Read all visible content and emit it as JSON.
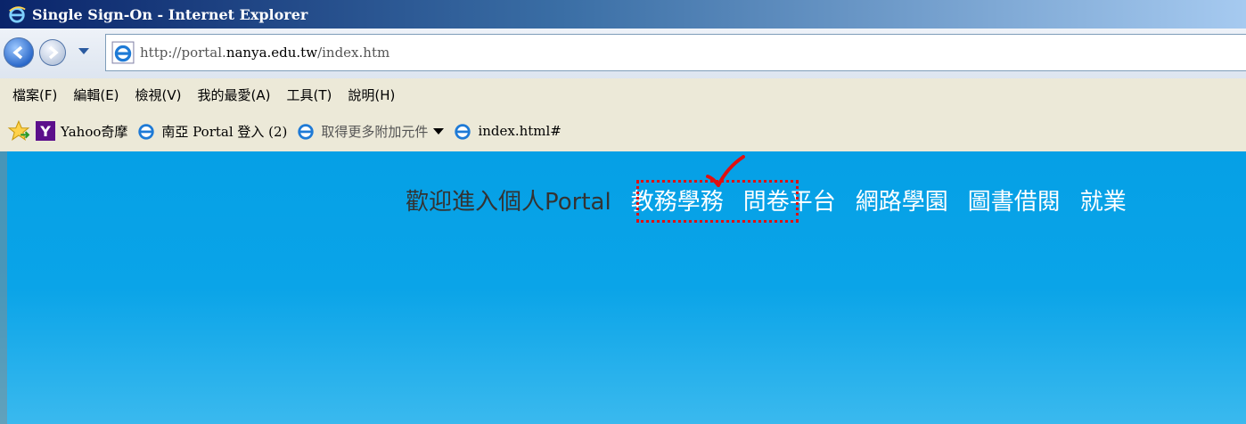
{
  "window": {
    "title": "Single Sign-On - Internet Explorer"
  },
  "address": {
    "url_prefix": "http://portal.",
    "url_domain": "nanya.edu.tw",
    "url_suffix": "/index.htm"
  },
  "menubar": {
    "items": [
      {
        "label": "檔案(F)"
      },
      {
        "label": "編輯(E)"
      },
      {
        "label": "檢視(V)"
      },
      {
        "label": "我的最愛(A)"
      },
      {
        "label": "工具(T)"
      },
      {
        "label": "說明(H)"
      }
    ]
  },
  "favorites": {
    "items": [
      {
        "label": "Yahoo奇摩",
        "icon": "yahoo-icon"
      },
      {
        "label": "南亞 Portal 登入 (2)",
        "icon": "ie-page-icon"
      },
      {
        "label": "取得更多附加元件",
        "icon": "ie-page-icon"
      },
      {
        "label": "index.html#",
        "icon": "ie-page-icon"
      }
    ]
  },
  "page": {
    "welcome": "歡迎進入個人Portal",
    "nav": [
      {
        "label": "教務學務"
      },
      {
        "label": "問卷平台"
      },
      {
        "label": "網路學園"
      },
      {
        "label": "圖書借閱"
      },
      {
        "label": "就業"
      }
    ]
  },
  "colors": {
    "content_bg": "#05a0e6",
    "highlight": "#e01010",
    "titlebar": "#0a246a"
  }
}
